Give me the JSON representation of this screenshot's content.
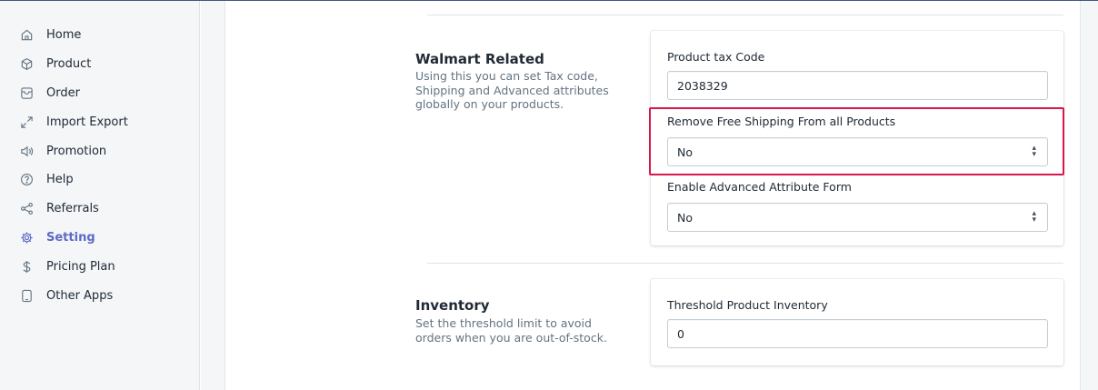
{
  "sidebar": {
    "items": [
      {
        "label": "Home",
        "icon": "home-icon"
      },
      {
        "label": "Product",
        "icon": "box-icon"
      },
      {
        "label": "Order",
        "icon": "inbox-icon"
      },
      {
        "label": "Import Export",
        "icon": "arrows-expand-icon"
      },
      {
        "label": "Promotion",
        "icon": "megaphone-icon"
      },
      {
        "label": "Help",
        "icon": "question-circle-icon"
      },
      {
        "label": "Referrals",
        "icon": "share-icon"
      },
      {
        "label": "Setting",
        "icon": "gear-icon",
        "active": true
      },
      {
        "label": "Pricing Plan",
        "icon": "dollar-icon"
      },
      {
        "label": "Other Apps",
        "icon": "mobile-icon"
      }
    ]
  },
  "walmart": {
    "title": "Walmart Related",
    "description": "Using this you can set Tax code, Shipping and Advanced attributes globally on your products.",
    "tax_code_label": "Product tax Code",
    "tax_code_value": "2038329",
    "free_shipping_label": "Remove Free Shipping From all Products",
    "free_shipping_value": "No",
    "advanced_attr_label": "Enable Advanced Attribute Form",
    "advanced_attr_value": "No"
  },
  "inventory": {
    "title": "Inventory",
    "description": "Set the threshold limit to avoid orders when you are out-of-stock.",
    "threshold_label": "Threshold Product Inventory",
    "threshold_value": "0"
  },
  "colors": {
    "accent": "#5c6ac4",
    "highlight": "#d8174a"
  }
}
